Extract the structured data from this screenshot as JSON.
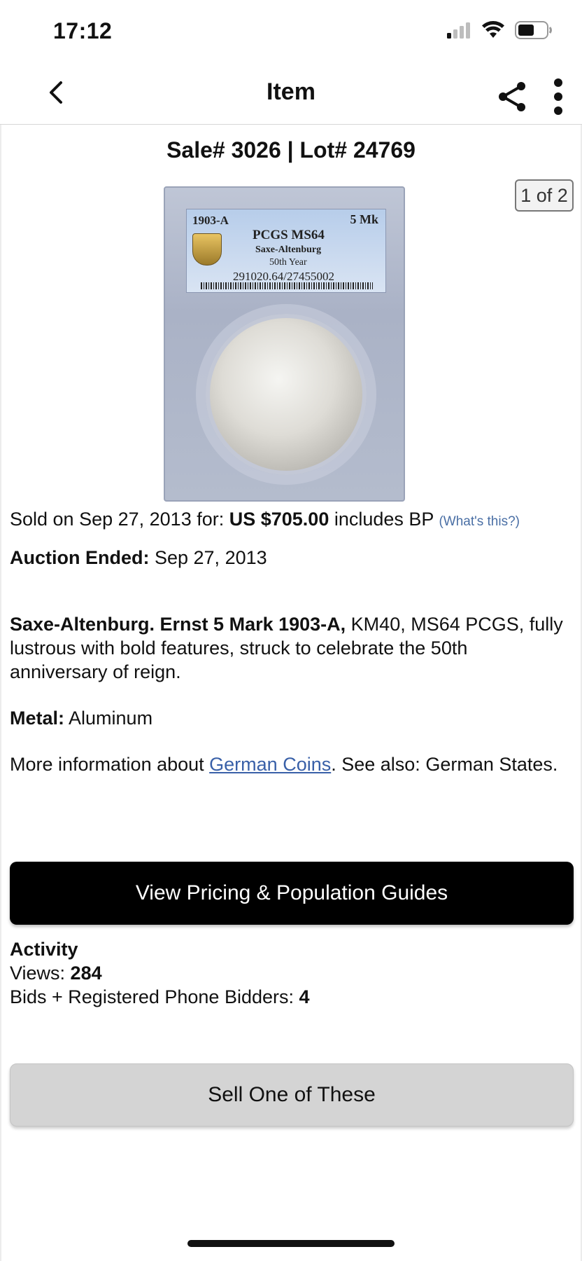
{
  "status_bar": {
    "time": "17:12",
    "icons": [
      "signal-icon",
      "wifi-icon",
      "battery-icon"
    ]
  },
  "nav": {
    "title": "Item",
    "icons": [
      "chevron-left-icon",
      "share-icon",
      "more-vertical-icon"
    ]
  },
  "item": {
    "lot_title": "Sale# 3026 | Lot# 24769",
    "image_counter": "1 of 2",
    "slab_label": {
      "date_mint": "1903-A",
      "denomination": "5 Mk",
      "grade": "PCGS MS64",
      "region": "Saxe-Altenburg",
      "variety": "50th Year",
      "cert": "291020.64/27455002"
    },
    "sold_prefix": "Sold on Sep 27, 2013 for: ",
    "sold_price": "US $705.00",
    "sold_suffix": " includes BP ",
    "whats_this": "(What's this?)",
    "auction_ended_label": "Auction Ended:",
    "auction_ended_value": " Sep 27, 2013",
    "desc_bold": "Saxe-Altenburg. Ernst 5 Mark 1903-A,",
    "desc_rest": " KM40, MS64 PCGS, fully lustrous with bold features, struck to celebrate the 50th anniversary of reign.",
    "metal_label": "Metal:",
    "metal_value": " Aluminum",
    "more_prefix": "More information about ",
    "more_link": "German Coins",
    "more_suffix": ". See also: German States."
  },
  "buttons": {
    "pricing": "View Pricing & Population Guides",
    "sell": "Sell One of These"
  },
  "activity": {
    "heading": "Activity",
    "views_label": "Views: ",
    "views_value": "284",
    "bids_label": "Bids + Registered Phone Bidders: ",
    "bids_value": "4"
  },
  "colors": {
    "link": "#3960a8",
    "primary_button": "#000000",
    "secondary_button": "#d4d4d4"
  }
}
